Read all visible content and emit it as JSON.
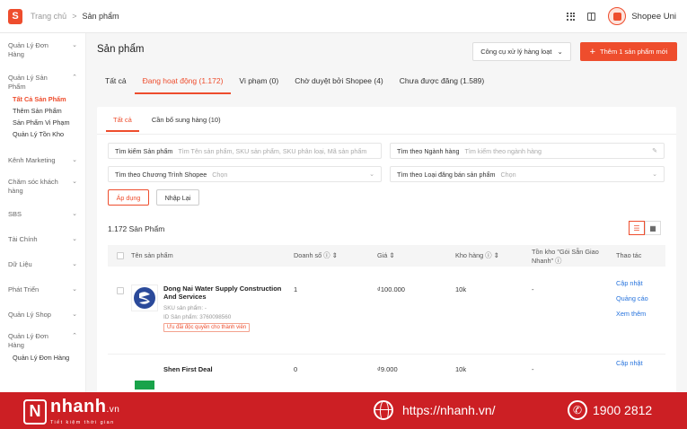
{
  "header": {
    "logo_letter": "S",
    "breadcrumb_home": "Trang chủ",
    "breadcrumb_sep": ">",
    "breadcrumb_current": "Sản phẩm",
    "shop_name": "Shopee Uni"
  },
  "sidebar": {
    "groups": [
      {
        "label": "Quản Lý Đơn Hàng",
        "chev": "⌄"
      },
      {
        "label": "Quản Lý Sản Phẩm",
        "chev": "⌃",
        "items": [
          "Tất Cả Sản Phẩm",
          "Thêm Sản Phẩm",
          "Sản Phẩm Vi Phạm",
          "Quản Lý Tồn Kho"
        ],
        "active_item": 0
      },
      {
        "label": "Kênh Marketing",
        "chev": "⌄"
      },
      {
        "label": "Chăm sóc khách hàng",
        "chev": "⌄"
      },
      {
        "label": "SBS",
        "chev": "⌄"
      },
      {
        "label": "Tài Chính",
        "chev": "⌄"
      },
      {
        "label": "Dữ Liệu",
        "chev": "⌄"
      },
      {
        "label": "Phát Triển",
        "chev": "⌄"
      },
      {
        "label": "Quản Lý Shop",
        "chev": "⌄"
      },
      {
        "label": "Quản Lý Đơn Hàng",
        "chev": "⌃",
        "items": [
          "Quản Lý Đơn Hàng"
        ]
      }
    ]
  },
  "main": {
    "title": "Sản phẩm",
    "bulk_tool": "Công cụ xử lý hàng loạt",
    "add_button": "Thêm 1 sản phẩm mới",
    "tabs": [
      "Tất cả",
      "Đang hoạt động (1.172)",
      "Vi phạm (0)",
      "Chờ duyệt bởi Shopee (4)",
      "Chưa được đăng (1.589)"
    ],
    "active_tab": 1,
    "subtabs": [
      "Tất cả",
      "Cần bổ sung hàng (10)"
    ],
    "filters": {
      "product_label": "Tìm kiếm Sản phẩm",
      "product_placeholder": "Tìm Tên sản phẩm, SKU sản phẩm, SKU phân loại, Mã sản phẩm",
      "category_label": "Tìm theo Ngành hàng",
      "category_placeholder": "Tìm kiếm theo ngành hàng",
      "program_label": "Tìm theo Chương Trình Shopee",
      "program_value": "Chọn",
      "type_label": "Tìm theo Loại đăng bán sản phẩm",
      "type_value": "Chọn"
    },
    "apply_button": "Áp dụng",
    "reset_button": "Nhập Lại",
    "count_text": "1.172 Sản Phẩm",
    "table": {
      "headers": {
        "name": "Tên sản phẩm",
        "sales": "Doanh số",
        "price": "Giá",
        "stock": "Kho hàng",
        "shopee_stock": "Tồn kho \"Gói Sẵn Giao Nhanh\"",
        "actions": "Thao tác"
      },
      "rows": [
        {
          "name": "Dong Nai Water Supply Construction And Services",
          "sku": "SKU sản phẩm: -",
          "id": "ID Sản phẩm: 3760098560",
          "badge": "Ưu đãi độc quyền cho thành viên",
          "sales": "1",
          "price": "₫100.000",
          "stock": "10k",
          "shopee_stock": "-",
          "actions": [
            "Cập nhật",
            "Quảng cáo",
            "Xem thêm"
          ]
        },
        {
          "name": "Shen First Deal",
          "sales": "0",
          "price": "₫9.000",
          "stock": "10k",
          "shopee_stock": "-",
          "actions": [
            "Cập nhật"
          ]
        }
      ]
    }
  },
  "banner": {
    "brand": "nhanh",
    "brand_suffix": ".vn",
    "slogan": "Tiết kiệm thời gian",
    "url": "https://nhanh.vn/",
    "phone": "1900 2812"
  },
  "colors": {
    "accent": "#ee4d2d",
    "link": "#2673dd",
    "banner": "#cc1f24"
  }
}
